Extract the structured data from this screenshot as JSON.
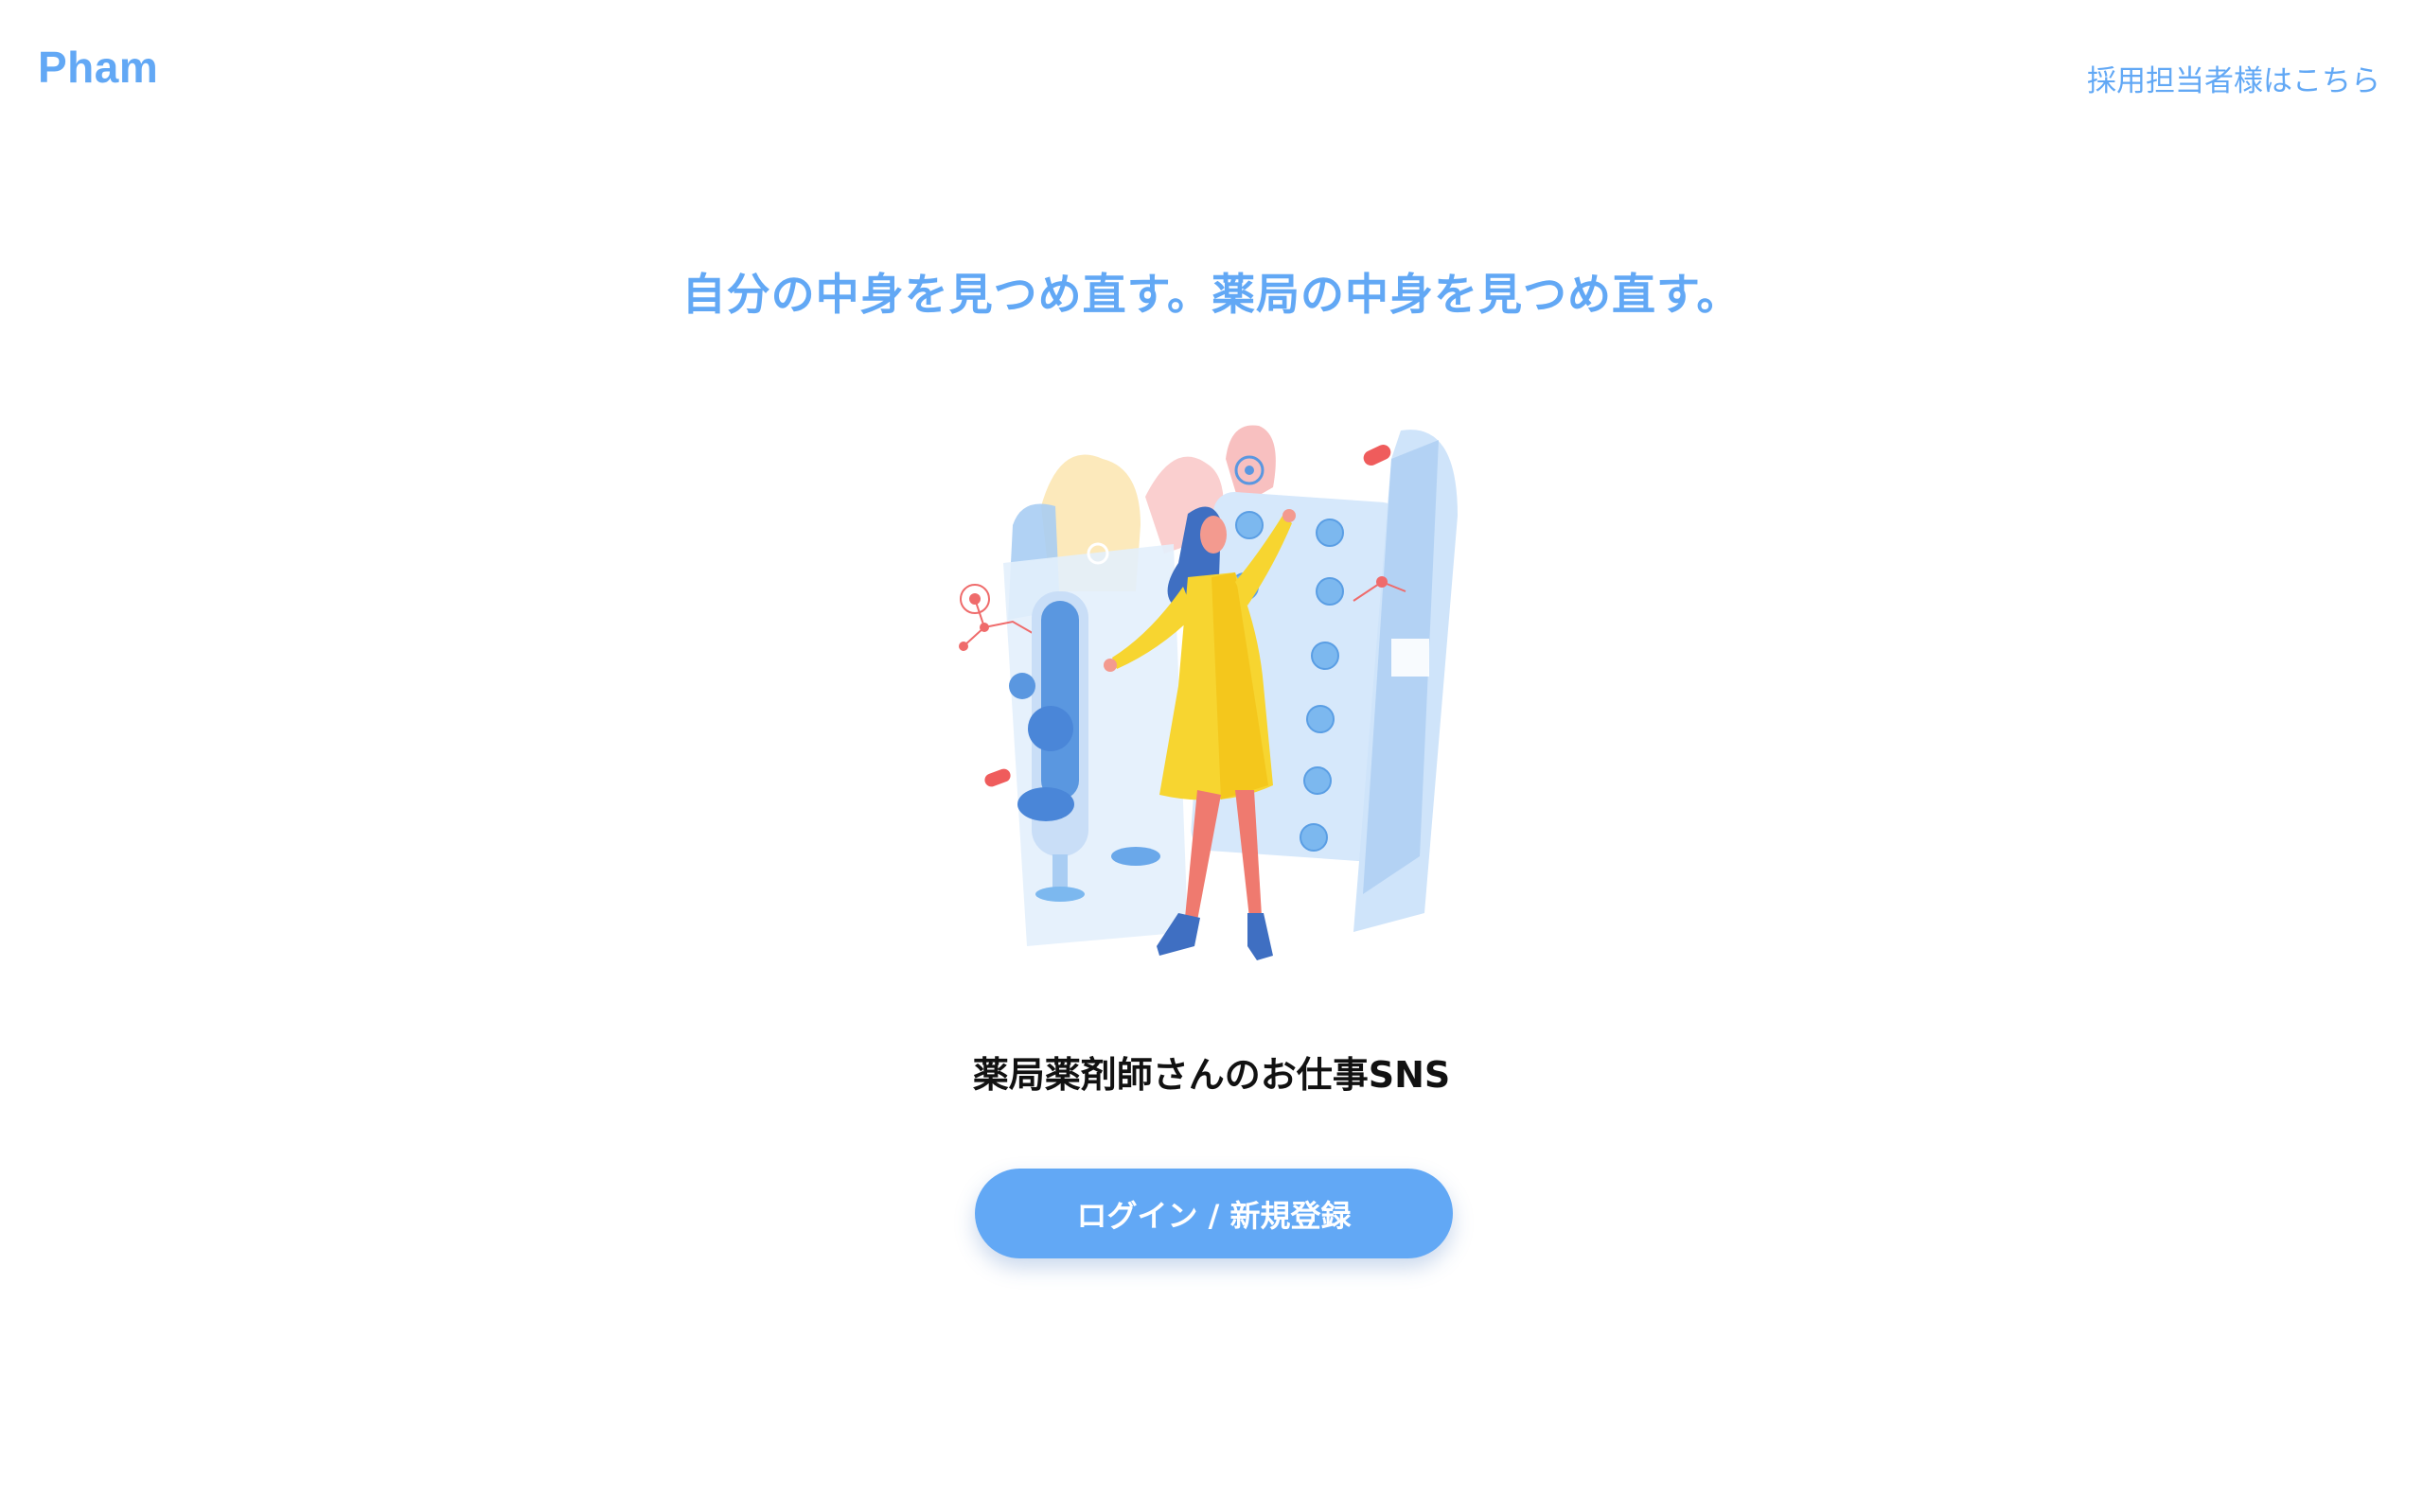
{
  "header": {
    "logo_text": "Pham",
    "recruiter_link": "採用担当者様はこちら"
  },
  "hero": {
    "tagline": "自分の中身を見つめ直す。薬局の中身を見つめ直す。",
    "subtitle": "薬局薬剤師さんのお仕事SNS",
    "cta_label": "ログイン / 新規登録"
  },
  "colors": {
    "accent": "#62a8f5",
    "text_dark": "#111111",
    "illustration_coat": "#f7d530",
    "illustration_hair": "#3f6fc2",
    "illustration_legs": "#ef7a6f"
  }
}
